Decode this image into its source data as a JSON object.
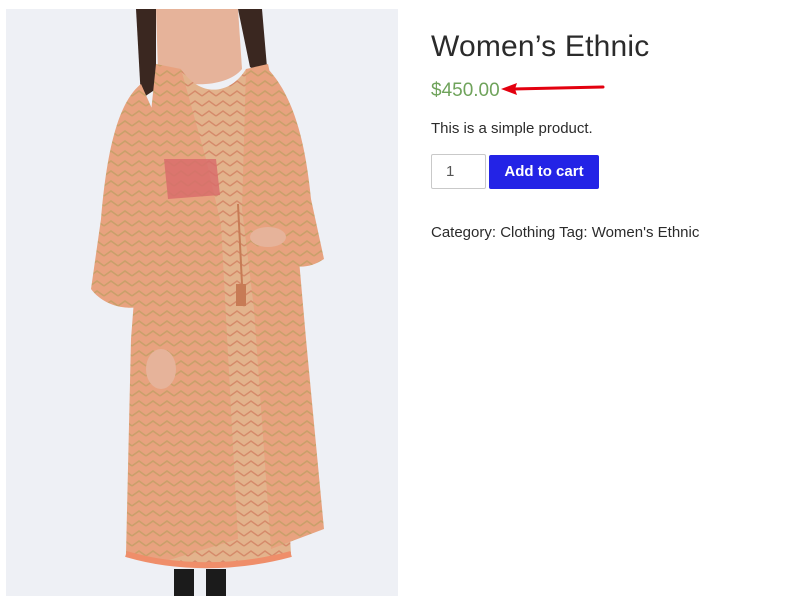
{
  "product": {
    "image_alt": "Women's Ethnic kurta with open jacket",
    "title": "Women’s Ethnic",
    "price": "$450.00",
    "short_description": "This is a simple product.",
    "quantity": "1",
    "add_to_cart_label": "Add to cart",
    "meta": {
      "category_label": "Category:",
      "category_value": "Clothing",
      "tag_label": "Tag:",
      "tag_value": "Women's Ethnic"
    }
  },
  "colors": {
    "price": "#6fa35b",
    "button_bg": "#2323e6",
    "annotation_arrow": "#e3000f"
  },
  "icons": {
    "annotation": "left-arrow-icon"
  }
}
